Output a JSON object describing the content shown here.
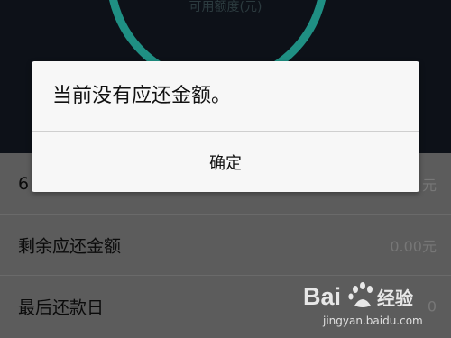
{
  "background": {
    "ring_label": "可用额度(元)",
    "accent_color": "#1f8f83"
  },
  "list": {
    "rows": [
      {
        "label": "6",
        "value": "元"
      },
      {
        "label": "剩余应还金额",
        "value": "0.00元"
      },
      {
        "label": "最后还款日",
        "value": "0"
      }
    ]
  },
  "dialog": {
    "message": "当前没有应还金额。",
    "confirm_label": "确定"
  },
  "watermark": {
    "brand": "Bai  经验",
    "url": "jingyan.baidu.com"
  }
}
